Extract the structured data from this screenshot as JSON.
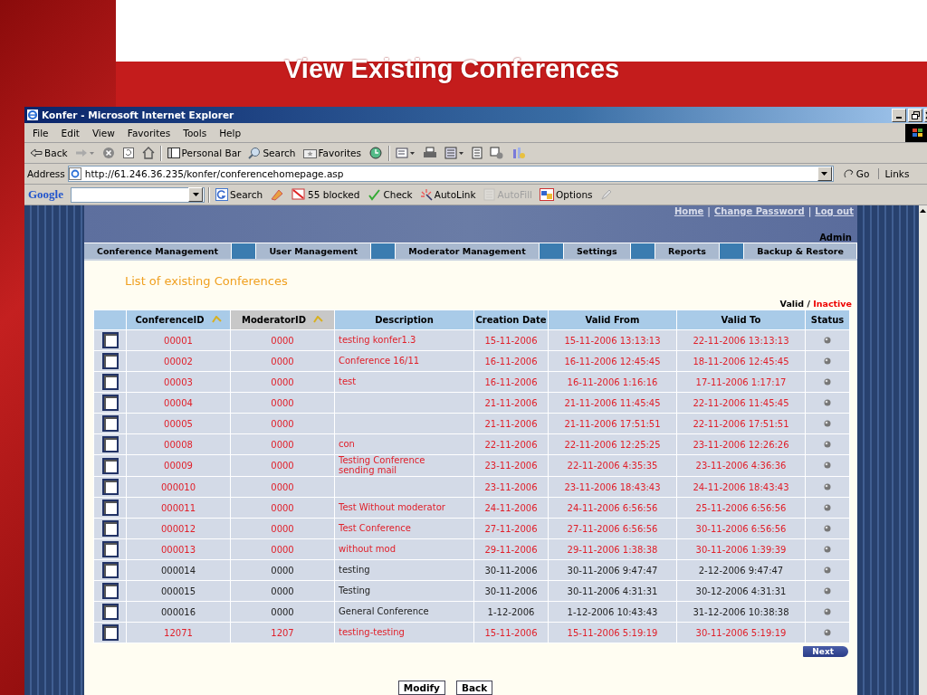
{
  "slide": {
    "title": "View Existing Conferences"
  },
  "window": {
    "title": "Konfer - Microsoft Internet Explorer"
  },
  "menu": [
    "File",
    "Edit",
    "View",
    "Favorites",
    "Tools",
    "Help"
  ],
  "toolbar": [
    {
      "kind": "back",
      "label": "Back"
    },
    {
      "kind": "forward"
    },
    {
      "kind": "stop"
    },
    {
      "kind": "refresh"
    },
    {
      "kind": "home"
    },
    {
      "kind": "sep"
    },
    {
      "kind": "panel",
      "label": "Personal Bar"
    },
    {
      "kind": "search",
      "label": "Search"
    },
    {
      "kind": "favorites",
      "label": "Favorites"
    },
    {
      "kind": "history"
    },
    {
      "kind": "sep"
    },
    {
      "kind": "mail"
    },
    {
      "kind": "print"
    },
    {
      "kind": "edit"
    },
    {
      "kind": "doc"
    },
    {
      "kind": "msg"
    },
    {
      "kind": "tool"
    }
  ],
  "address": {
    "label": "Address",
    "url": "http://61.246.36.235/konfer/conferencehomepage.asp",
    "go": "Go",
    "links": "Links"
  },
  "google_bar": {
    "logo": "Google",
    "items": [
      {
        "kind": "search",
        "label": "Search",
        "disabled": false
      },
      {
        "kind": "news",
        "disabled": false
      },
      {
        "kind": "blocked",
        "label": "55 blocked",
        "disabled": false
      },
      {
        "kind": "check",
        "label": "Check",
        "disabled": false
      },
      {
        "kind": "autolink",
        "label": "AutoLink",
        "disabled": false
      },
      {
        "kind": "autofill",
        "label": "AutoFill",
        "disabled": true
      },
      {
        "kind": "options",
        "label": "Options",
        "disabled": false
      },
      {
        "kind": "pen",
        "disabled": false
      }
    ]
  },
  "header": {
    "links": [
      "Home",
      "Change Password",
      "Log out"
    ],
    "separator": "|",
    "user": "Admin"
  },
  "nav": [
    "Conference Management",
    "User Management",
    "Moderator Management",
    "Settings",
    "Reports",
    "Backup & Restore"
  ],
  "heading": "List of existing Conferences",
  "legend": {
    "valid": "Valid",
    "separator": "/",
    "inactive": "Inactive"
  },
  "table": {
    "columns": [
      {
        "label": "ConferenceID",
        "sortable": true,
        "sorted": false
      },
      {
        "label": "ModeratorID",
        "sortable": true,
        "sorted": true
      },
      {
        "label": "Description",
        "sortable": false,
        "sorted": false
      },
      {
        "label": "Creation Date",
        "sortable": false,
        "sorted": false
      },
      {
        "label": "Valid From",
        "sortable": false,
        "sorted": false
      },
      {
        "label": "Valid To",
        "sortable": false,
        "sorted": false
      },
      {
        "label": "Status",
        "sortable": false,
        "sorted": false
      }
    ],
    "rows": [
      {
        "checked": false,
        "inactive": true,
        "cells": [
          "00001",
          "0000",
          "testing konfer1.3",
          "15-11-2006",
          "15-11-2006 13:13:13",
          "22-11-2006 13:13:13"
        ]
      },
      {
        "checked": false,
        "inactive": true,
        "cells": [
          "00002",
          "0000",
          "Conference 16/11",
          "16-11-2006",
          "16-11-2006 12:45:45",
          "18-11-2006 12:45:45"
        ]
      },
      {
        "checked": false,
        "inactive": true,
        "cells": [
          "00003",
          "0000",
          "test",
          "16-11-2006",
          "16-11-2006 1:16:16",
          "17-11-2006 1:17:17"
        ]
      },
      {
        "checked": false,
        "inactive": true,
        "cells": [
          "00004",
          "0000",
          "",
          "21-11-2006",
          "21-11-2006 11:45:45",
          "22-11-2006 11:45:45"
        ]
      },
      {
        "checked": false,
        "inactive": true,
        "cells": [
          "00005",
          "0000",
          "",
          "21-11-2006",
          "21-11-2006 17:51:51",
          "22-11-2006 17:51:51"
        ]
      },
      {
        "checked": false,
        "inactive": true,
        "cells": [
          "00008",
          "0000",
          "con",
          "22-11-2006",
          "22-11-2006 12:25:25",
          "23-11-2006 12:26:26"
        ]
      },
      {
        "checked": false,
        "inactive": true,
        "cells": [
          "00009",
          "0000",
          "Testing Conference sending mail",
          "23-11-2006",
          "22-11-2006 4:35:35",
          "23-11-2006 4:36:36"
        ]
      },
      {
        "checked": false,
        "inactive": true,
        "cells": [
          "000010",
          "0000",
          "",
          "23-11-2006",
          "23-11-2006 18:43:43",
          "24-11-2006 18:43:43"
        ]
      },
      {
        "checked": false,
        "inactive": true,
        "cells": [
          "000011",
          "0000",
          "Test Without moderator",
          "24-11-2006",
          "24-11-2006 6:56:56",
          "25-11-2006 6:56:56"
        ]
      },
      {
        "checked": false,
        "inactive": true,
        "cells": [
          "000012",
          "0000",
          "Test Conference",
          "27-11-2006",
          "27-11-2006 6:56:56",
          "30-11-2006 6:56:56"
        ]
      },
      {
        "checked": false,
        "inactive": true,
        "cells": [
          "000013",
          "0000",
          "without mod",
          "29-11-2006",
          "29-11-2006 1:38:38",
          "30-11-2006 1:39:39"
        ]
      },
      {
        "checked": false,
        "inactive": false,
        "cells": [
          "000014",
          "0000",
          "testing",
          "30-11-2006",
          "30-11-2006 9:47:47",
          "2-12-2006 9:47:47"
        ]
      },
      {
        "checked": false,
        "inactive": false,
        "cells": [
          "000015",
          "0000",
          "Testing",
          "30-11-2006",
          "30-11-2006 4:31:31",
          "30-12-2006 4:31:31"
        ]
      },
      {
        "checked": false,
        "inactive": false,
        "cells": [
          "000016",
          "0000",
          "General Conference",
          "1-12-2006",
          "1-12-2006 10:43:43",
          "31-12-2006 10:38:38"
        ]
      },
      {
        "checked": false,
        "inactive": true,
        "cells": [
          "12071",
          "1207",
          "testing-testing",
          "15-11-2006",
          "15-11-2006 5:19:19",
          "30-11-2006 5:19:19"
        ]
      }
    ]
  },
  "next": "Next",
  "buttons": [
    "Modify",
    "Back"
  ]
}
